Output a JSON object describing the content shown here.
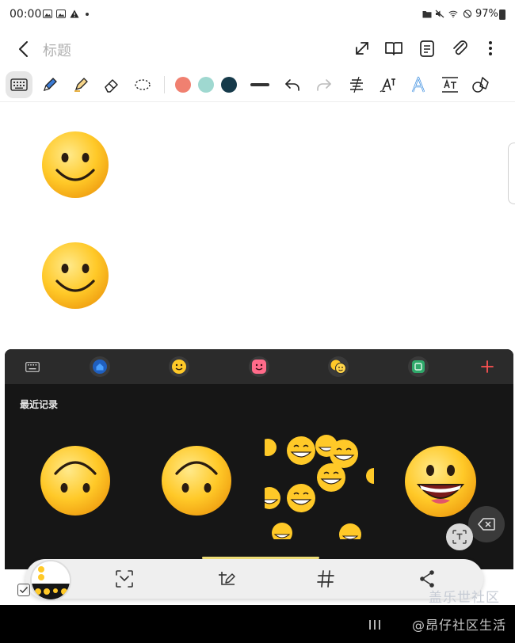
{
  "status_bar": {
    "time": "00:00",
    "battery": "97%"
  },
  "title_bar": {
    "title_placeholder": "标题",
    "icons": [
      "back-arrow-icon",
      "expand-icon",
      "book-icon",
      "page-icon",
      "attach-icon",
      "more-vert-icon"
    ]
  },
  "tools": {
    "icons": [
      "keyboard-icon",
      "pen-icon",
      "highlighter-icon",
      "eraser-icon",
      "lasso-select-icon"
    ],
    "colors": [
      "#f08070",
      "#9fd8d0",
      "#163a4a"
    ],
    "more_icons": [
      "stroke-width-icon",
      "undo-icon",
      "redo-icon",
      "text-align-icon",
      "handwriting-to-text-icon",
      "text-style-icon",
      "text-size-icon",
      "shapes-icon"
    ]
  },
  "emoji_panel": {
    "recent_label": "最近记录",
    "categories": [
      "keyboard-icon",
      "home-icon",
      "smiley-icon",
      "sticker-face-icon",
      "animated-emoji-icon",
      "gif-sticker-icon",
      "add-icon"
    ],
    "accent_color": "#ff5252"
  },
  "bottom_toolbar": {
    "icons": [
      "note-thumbnail",
      "scan-icon",
      "edit-image-icon",
      "hashtag-icon",
      "share-icon"
    ]
  },
  "watermarks": {
    "line1": "盖乐世社区",
    "line2": "@昂仔社区生活"
  }
}
